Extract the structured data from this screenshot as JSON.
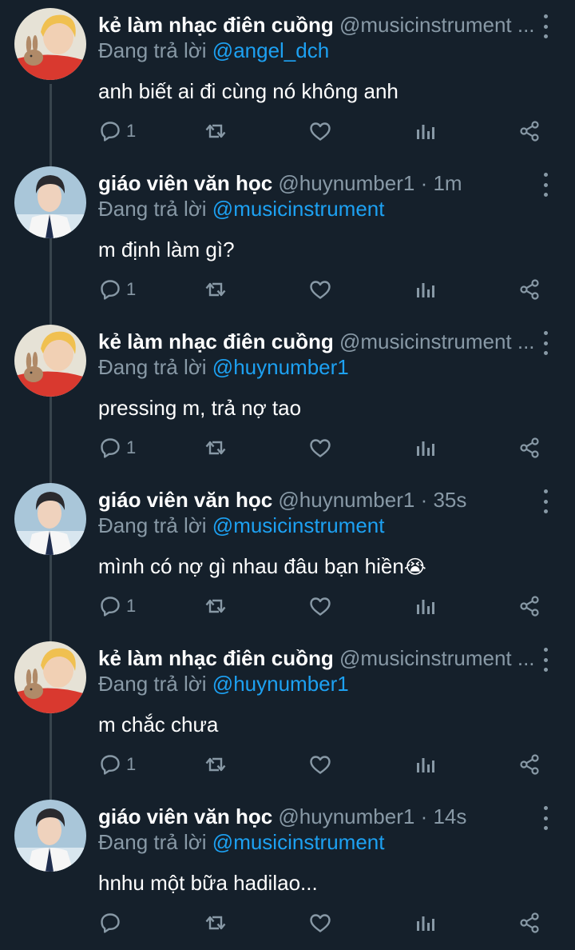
{
  "tweets": [
    {
      "author": "kẻ làm nhạc điên cuồng",
      "handle": "@musicinstrument ...",
      "time": "",
      "reply_prefix": "Đang trả lời",
      "reply_to": "@angel_dch",
      "text": "anh biết ai đi cùng nó không anh",
      "emoji": "",
      "reply_count": "1",
      "avatar": "rabbit-avatar"
    },
    {
      "author": "giáo viên văn học",
      "handle": "@huynumber1",
      "time": " · 1m",
      "reply_prefix": "Đang trả lời",
      "reply_to": "@musicinstrument",
      "text": "m định làm gì?",
      "emoji": "",
      "reply_count": "1",
      "avatar": "uniform-avatar"
    },
    {
      "author": "kẻ làm nhạc điên cuồng",
      "handle": "@musicinstrument ...",
      "time": "",
      "reply_prefix": "Đang trả lời",
      "reply_to": "@huynumber1",
      "text": "pressing m, trả nợ tao",
      "emoji": "",
      "reply_count": "1",
      "avatar": "rabbit-avatar"
    },
    {
      "author": "giáo viên văn học",
      "handle": "@huynumber1",
      "time": " · 35s",
      "reply_prefix": "Đang trả lời",
      "reply_to": "@musicinstrument",
      "text": "mình có nợ gì nhau đâu bạn hiền",
      "emoji": "😭",
      "reply_count": "1",
      "avatar": "uniform-avatar"
    },
    {
      "author": "kẻ làm nhạc điên cuồng",
      "handle": "@musicinstrument ...",
      "time": "",
      "reply_prefix": "Đang trả lời",
      "reply_to": "@huynumber1",
      "text": "m chắc chưa",
      "emoji": "",
      "reply_count": "1",
      "avatar": "rabbit-avatar"
    },
    {
      "author": "giáo viên văn học",
      "handle": "@huynumber1",
      "time": " · 14s",
      "reply_prefix": "Đang trả lời",
      "reply_to": "@musicinstrument",
      "text": "hnhu một bữa hadilao...",
      "emoji": "",
      "reply_count": "",
      "avatar": "uniform-avatar"
    }
  ],
  "icons": {
    "reply": "reply-icon",
    "retweet": "retweet-icon",
    "like": "heart-icon",
    "analytics": "analytics-icon",
    "share": "share-icon",
    "more": "more-icon"
  },
  "colors": {
    "background": "#15202b",
    "text": "#ffffff",
    "secondary": "#8899a6",
    "link": "#1da1f2",
    "thread_line": "#38444d"
  }
}
